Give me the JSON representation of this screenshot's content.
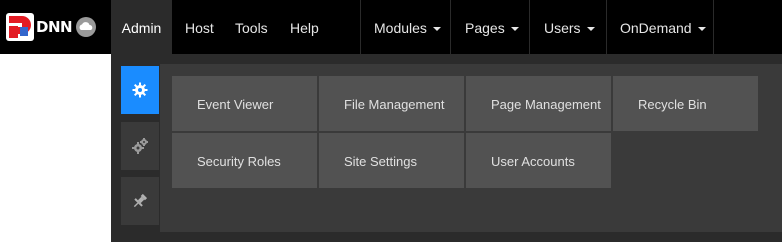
{
  "brand": {
    "logo_text": "DNN"
  },
  "nav": {
    "left": [
      "Admin",
      "Host",
      "Tools",
      "Help"
    ],
    "right": [
      "Modules",
      "Pages",
      "Users",
      "OnDemand"
    ],
    "active": "Admin"
  },
  "side_tabs": [
    {
      "icon": "gear-icon",
      "active": true
    },
    {
      "icon": "gears-icon",
      "active": false
    },
    {
      "icon": "pin-icon",
      "active": false
    }
  ],
  "tiles": [
    "Event Viewer",
    "File Management",
    "Page Management",
    "Recycle Bin",
    "Security Roles",
    "Site Settings",
    "User Accounts"
  ],
  "colors": {
    "topbar": "#000000",
    "dropdown": "#2b2b2b",
    "panel": "#3a3a3a",
    "tile": "#525252",
    "accent": "#1a8cff",
    "brand_red": "#e31b23"
  }
}
